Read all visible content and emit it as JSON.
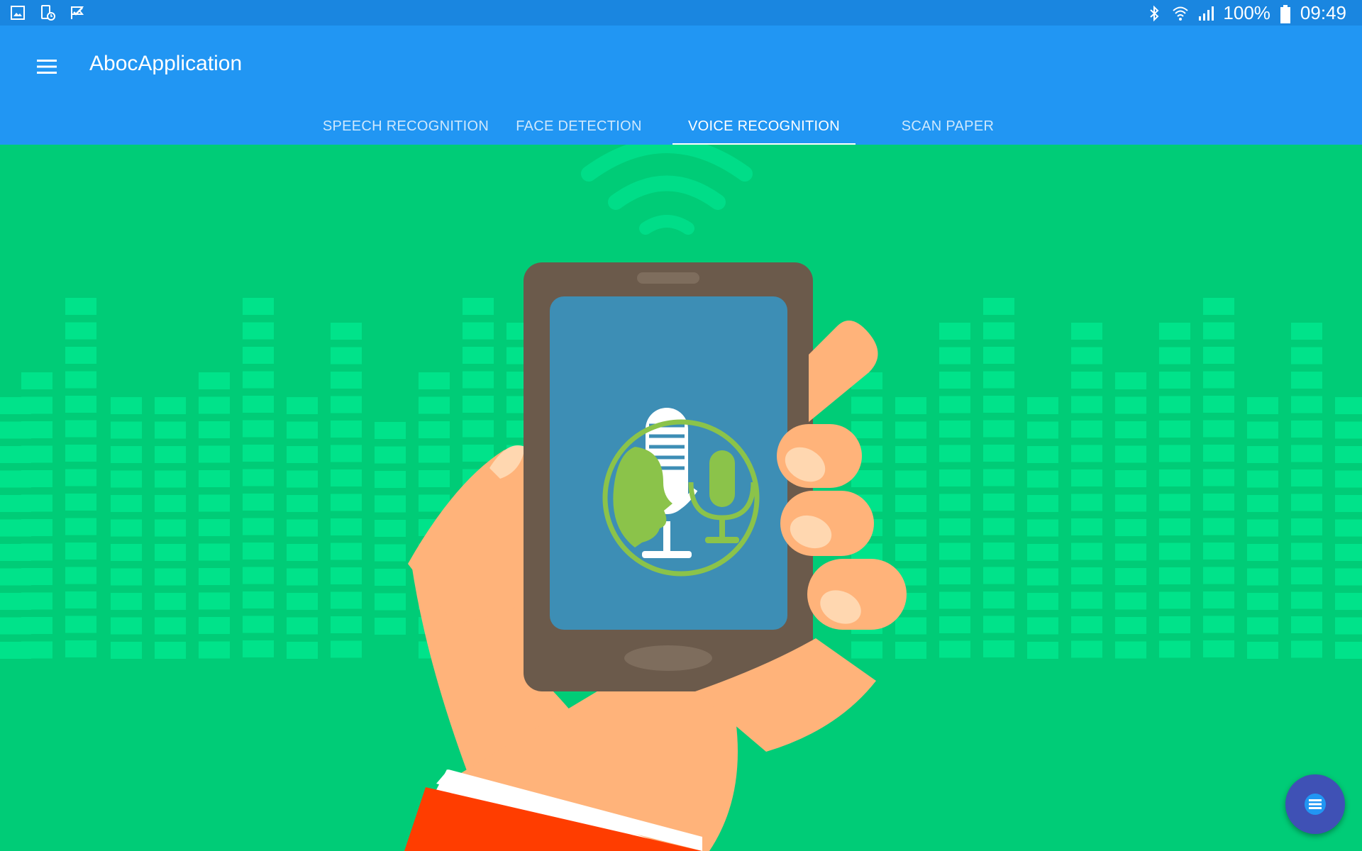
{
  "status_bar": {
    "left_icons": [
      "image-icon",
      "device-clock-icon",
      "check-flag-icon"
    ],
    "right_icons": [
      "bluetooth-icon",
      "wifi-icon",
      "signal-icon",
      "battery-icon"
    ],
    "battery": "100%",
    "time": "09:49"
  },
  "app_bar": {
    "menu_icon": "hamburger-menu-icon",
    "title": "AbocApplication",
    "tabs": [
      {
        "label": "SPEECH RECOGNITION",
        "active": false
      },
      {
        "label": "FACE DETECTION",
        "active": false
      },
      {
        "label": "VOICE RECOGNITION",
        "active": true
      },
      {
        "label": "SCAN PAPER",
        "active": false
      }
    ]
  },
  "main": {
    "illustration": "voice-recognition-illustration",
    "colors": {
      "background": "#00cc77",
      "accent": "#8bc34a"
    }
  },
  "fab": {
    "icon": "list-icon",
    "color": "#3f51b5"
  }
}
